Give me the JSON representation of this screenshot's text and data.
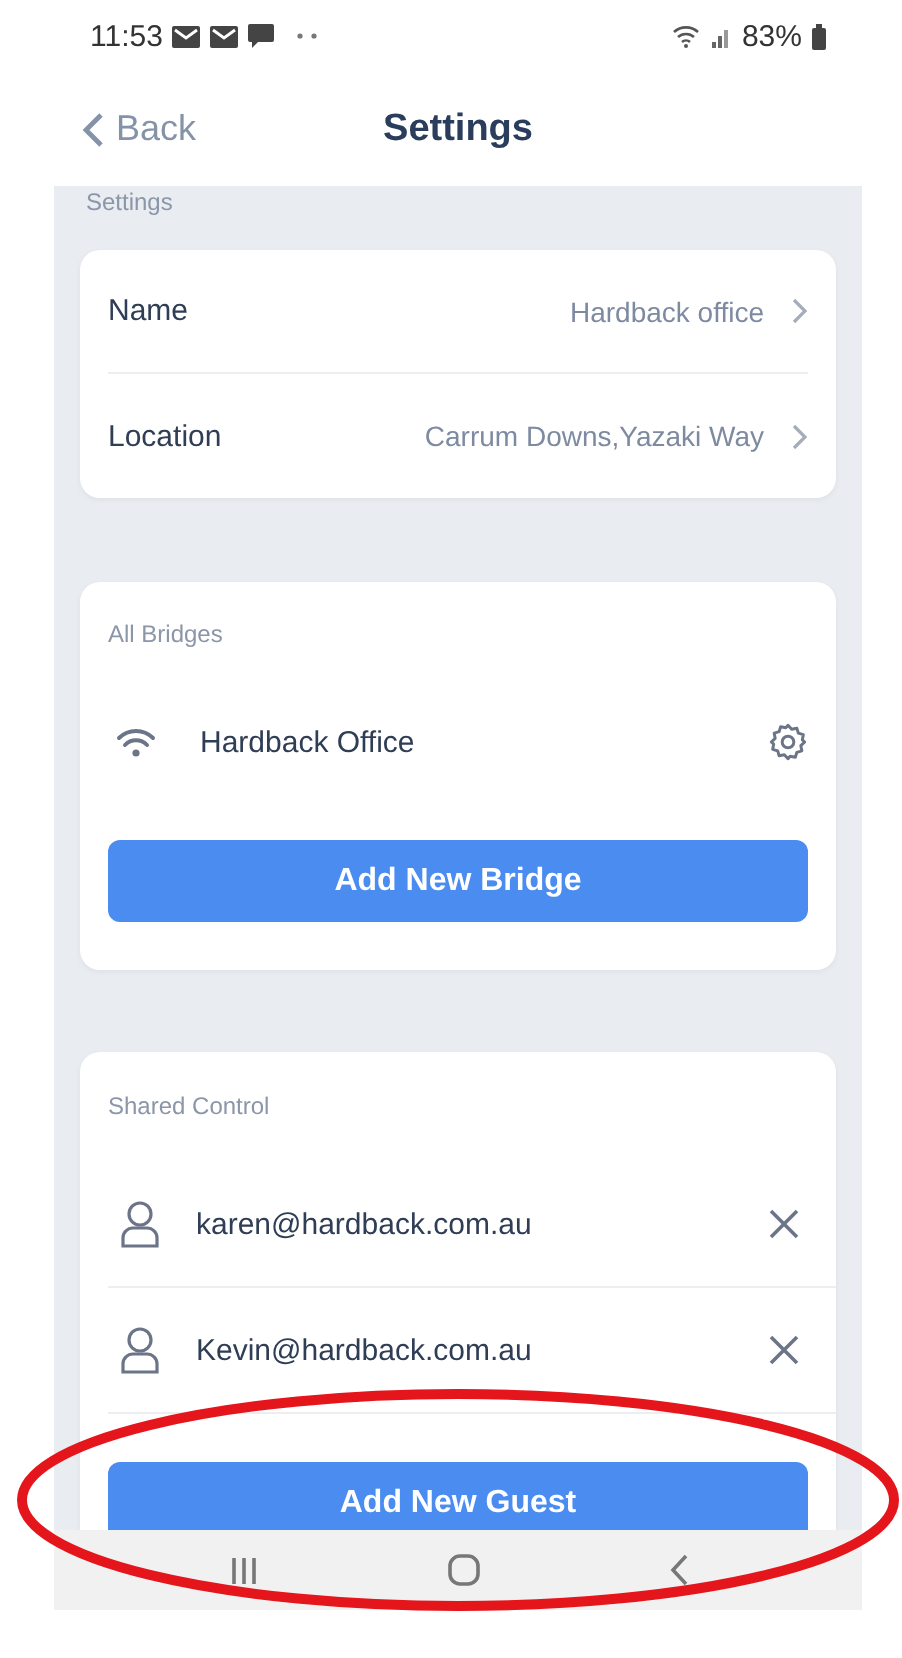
{
  "status_bar": {
    "time": "11:53",
    "battery": "83%"
  },
  "header": {
    "back": "Back",
    "title": "Settings"
  },
  "section_label": "Settings",
  "settings_rows": [
    {
      "label": "Name",
      "value": "Hardback office"
    },
    {
      "label": "Location",
      "value": "Carrum Downs,Yazaki Way"
    }
  ],
  "bridges": {
    "title": "All Bridges",
    "items": [
      {
        "name": "Hardback Office"
      }
    ],
    "button": "Add New Bridge"
  },
  "shared_control": {
    "title": "Shared Control",
    "guests": [
      {
        "email": "karen@hardback.com.au"
      },
      {
        "email": "Kevin@hardback.com.au"
      }
    ],
    "button": "Add New Guest"
  }
}
